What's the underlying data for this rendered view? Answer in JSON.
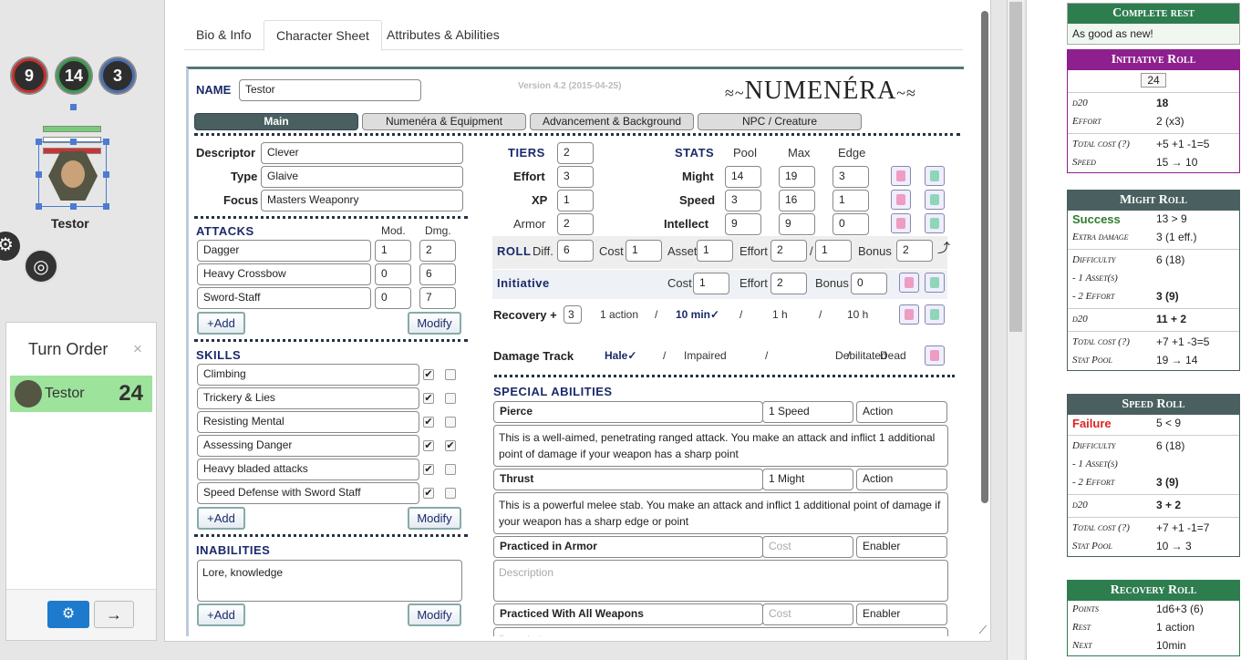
{
  "tokens": {
    "circles": [
      "9",
      "14",
      "3"
    ],
    "name": "Testor"
  },
  "turn_order": {
    "title": "Turn Order",
    "close": "×",
    "entry": {
      "name": "Testor",
      "value": "24"
    }
  },
  "tabs": [
    "Bio & Info",
    "Character Sheet",
    "Attributes & Abilities"
  ],
  "sheet": {
    "name_label": "NAME",
    "name": "Testor",
    "version": "Version 4.2 (2015-04-25)",
    "logo": "NUMENÉRA",
    "subtabs": [
      "Main",
      "Numenéra & Equipment",
      "Advancement & Background",
      "NPC / Creature"
    ],
    "descriptor_label": "Descriptor",
    "descriptor": "Clever",
    "type_label": "Type",
    "type": "Glaive",
    "focus_label": "Focus",
    "focus": "Masters Weaponry",
    "attacks_label": "ATTACKS",
    "mod_label": "Mod.",
    "dmg_label": "Dmg.",
    "attacks": [
      {
        "name": "Dagger",
        "mod": "1",
        "dmg": "2"
      },
      {
        "name": "Heavy Crossbow",
        "mod": "0",
        "dmg": "6"
      },
      {
        "name": "Sword-Staff",
        "mod": "0",
        "dmg": "7"
      }
    ],
    "add_label": "+Add",
    "modify_label": "Modify",
    "skills_label": "SKILLS",
    "skills": [
      {
        "name": "Climbing",
        "t": "✔",
        "s": ""
      },
      {
        "name": "Trickery & Lies",
        "t": "✔",
        "s": ""
      },
      {
        "name": "Resisting Mental",
        "t": "✔",
        "s": ""
      },
      {
        "name": "Assessing Danger",
        "t": "✔",
        "s": "✔"
      },
      {
        "name": "Heavy bladed attacks",
        "t": "✔",
        "s": ""
      },
      {
        "name": "Speed Defense with Sword Staff",
        "t": "✔",
        "s": ""
      }
    ],
    "inabilities_label": "INABILITIES",
    "inabilities": "Lore, knowledge",
    "tiers_label": "TIERS",
    "tiers": "2",
    "effort_label": "Effort",
    "effort": "3",
    "xp_label": "XP",
    "xp": "1",
    "armor_label": "Armor",
    "armor": "2",
    "stats_label": "STATS",
    "pool_label": "Pool",
    "max_label": "Max",
    "edge_label": "Edge",
    "stats": [
      {
        "name": "Might",
        "pool": "14",
        "max": "19",
        "edge": "3"
      },
      {
        "name": "Speed",
        "pool": "3",
        "max": "16",
        "edge": "1"
      },
      {
        "name": "Intellect",
        "pool": "9",
        "max": "9",
        "edge": "0"
      }
    ],
    "roll": {
      "label": "ROLL",
      "diff_label": "Diff.",
      "diff": "6",
      "cost_label": "Cost",
      "cost": "1",
      "asset_label": "Asset",
      "asset": "1",
      "effort_label": "Effort",
      "effort": "2",
      "effort2": "1",
      "bonus_label": "Bonus",
      "bonus": "2"
    },
    "initiative": {
      "label": "Initiative",
      "cost_label": "Cost",
      "cost": "1",
      "effort_label": "Effort",
      "effort": "2",
      "bonus_label": "Bonus",
      "bonus": "0"
    },
    "recovery": {
      "label": "Recovery +",
      "value": "3",
      "opts": [
        "1 action",
        "/",
        "10 min✓",
        "/",
        "1 h",
        "/",
        "10 h"
      ]
    },
    "damage": {
      "label": "Damage Track",
      "opts": [
        "Hale✓",
        "/",
        "Impaired",
        "/",
        "Debilitated",
        "/",
        "Dead"
      ]
    },
    "special_label": "SPECIAL ABILITIES",
    "abilities": [
      {
        "name": "Pierce",
        "cost": "1 Speed",
        "type": "Action",
        "desc": "This is a well-aimed, penetrating ranged attack. You make an attack and inflict 1 additional point of damage if your weapon has a sharp point"
      },
      {
        "name": "Thrust",
        "cost": "1 Might",
        "type": "Action",
        "desc": "This is a powerful melee stab. You make an attack and inflict 1 additional point of damage if your weapon has a sharp edge or point"
      },
      {
        "name": "Practiced in Armor",
        "cost": "Cost",
        "type": "Enabler",
        "desc": "Description"
      },
      {
        "name": "Practiced With All Weapons",
        "cost": "Cost",
        "type": "Enabler",
        "desc": "Description"
      }
    ]
  },
  "chat": {
    "complete": {
      "title": "Complete rest",
      "text": "As good as new!"
    },
    "initiative": {
      "title": "Initiative Roll",
      "total": "24",
      "rows": [
        [
          "d20",
          "18"
        ],
        [
          "Effort",
          "2 (x3)"
        ],
        [
          "Total cost (?)",
          "+5 +1 -1=5"
        ],
        [
          "Speed",
          "15 → 10"
        ]
      ]
    },
    "might": {
      "title": "Might Roll",
      "result": "Success",
      "result_val": "13 > 9",
      "rows": [
        [
          "Extra damage",
          "3 (1 eff.)"
        ],
        [
          "Difficulty",
          "6 (18)"
        ],
        [
          "- 1 Asset(s)",
          ""
        ],
        [
          "- 2 Effort",
          "3 (9)"
        ],
        [
          "d20",
          "11 + 2"
        ],
        [
          "Total cost (?)",
          "+7 +1 -3=5"
        ],
        [
          "Stat Pool",
          "19 → 14"
        ]
      ]
    },
    "speed": {
      "title": "Speed Roll",
      "result": "Failure",
      "result_val": "5 < 9",
      "rows": [
        [
          "Difficulty",
          "6 (18)"
        ],
        [
          "- 1 Asset(s)",
          ""
        ],
        [
          "- 2 Effort",
          "3 (9)"
        ],
        [
          "d20",
          "3 + 2"
        ],
        [
          "Total cost (?)",
          "+7 +1 -1=7"
        ],
        [
          "Stat Pool",
          "10 → 3"
        ]
      ]
    },
    "recovery": {
      "title": "Recovery Roll",
      "rows": [
        [
          "Points",
          "1d6+3 (6)"
        ],
        [
          "Rest",
          "1 action"
        ],
        [
          "Next",
          "10min"
        ]
      ]
    }
  },
  "colors": {
    "green": "#2e7d4f",
    "purple": "#8e1f8e",
    "slate": "#4a6060"
  }
}
